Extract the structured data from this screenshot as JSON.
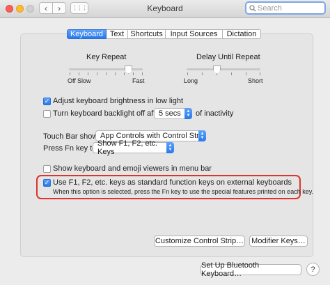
{
  "window": {
    "title": "Keyboard",
    "search_placeholder": "Search",
    "back_icon": "‹",
    "forward_icon": "›",
    "grid_icon": "⋮⋮⋮"
  },
  "tabs": [
    {
      "label": "Keyboard",
      "active": true
    },
    {
      "label": "Text",
      "active": false
    },
    {
      "label": "Shortcuts",
      "active": false
    },
    {
      "label": "Input Sources",
      "active": false
    },
    {
      "label": "Dictation",
      "active": false
    }
  ],
  "key_repeat": {
    "label": "Key Repeat",
    "left": "Off",
    "mid": "Slow",
    "right": "Fast",
    "level": 0.8
  },
  "delay_repeat": {
    "label": "Delay Until Repeat",
    "left": "Long",
    "right": "Short",
    "level": 0.35
  },
  "options": {
    "adjust_brightness": {
      "label": "Adjust keyboard brightness in low light",
      "checked": true
    },
    "backlight_off": {
      "label": "Turn keyboard backlight off after",
      "checked": false,
      "value": "5 secs",
      "suffix": "of inactivity"
    },
    "touch_bar": {
      "label": "Touch Bar shows",
      "value": "App Controls with Control Strip"
    },
    "fn_key": {
      "label": "Press Fn key to",
      "value": "Show F1, F2, etc. Keys"
    },
    "viewers_menu": {
      "label": "Show keyboard and emoji viewers in menu bar",
      "checked": false
    },
    "function_keys": {
      "label": "Use F1, F2, etc. keys as standard function keys on external keyboards",
      "checked": true,
      "note": "When this option is selected, press the Fn key to use the special features printed on each key."
    }
  },
  "buttons": {
    "customize": "Customize Control Strip…",
    "modifier": "Modifier Keys…",
    "bluetooth": "Set Up Bluetooth Keyboard…"
  },
  "colors": {
    "accent": "#2779ee",
    "highlight": "#e0332b"
  }
}
